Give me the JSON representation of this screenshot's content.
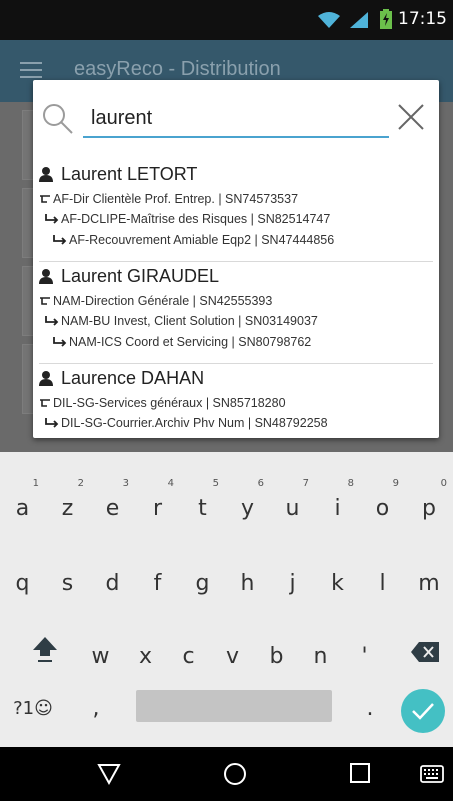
{
  "status": {
    "time": "17:15"
  },
  "app": {
    "title": "easyReco - Distribution"
  },
  "search": {
    "value": "laurent",
    "placeholder": ""
  },
  "results": [
    {
      "name": "Laurent LETORT",
      "lines": [
        "AF-Dir Clientèle Prof. Entrep. | SN74573537",
        "AF-DCLIPE-Maîtrise des Risques | SN82514747",
        "AF-Recouvrement Amiable Eqp2 | SN47444856"
      ]
    },
    {
      "name": "Laurent GIRAUDEL",
      "lines": [
        "NAM-Direction Générale | SN42555393",
        "NAM-BU Invest, Client Solution | SN03149037",
        "NAM-ICS Coord et Servicing | SN80798762"
      ]
    },
    {
      "name": "Laurence DAHAN",
      "lines": [
        "DIL-SG-Services généraux | SN85718280",
        "DIL-SG-Courrier.Archiv Phv Num | SN48792258"
      ]
    }
  ],
  "keyboard": {
    "row1": [
      {
        "ch": "a",
        "hint": "1"
      },
      {
        "ch": "z",
        "hint": "2"
      },
      {
        "ch": "e",
        "hint": "3"
      },
      {
        "ch": "r",
        "hint": "4"
      },
      {
        "ch": "t",
        "hint": "5"
      },
      {
        "ch": "y",
        "hint": "6"
      },
      {
        "ch": "u",
        "hint": "7"
      },
      {
        "ch": "i",
        "hint": "8"
      },
      {
        "ch": "o",
        "hint": "9"
      },
      {
        "ch": "p",
        "hint": "0"
      }
    ],
    "row2": [
      "q",
      "s",
      "d",
      "f",
      "g",
      "h",
      "j",
      "k",
      "l",
      "m"
    ],
    "row3": [
      "w",
      "x",
      "c",
      "v",
      "b",
      "n",
      "'"
    ],
    "symbols_label": "?1☺",
    "comma": ",",
    "period": "."
  },
  "colors": {
    "accent": "#4aa3cf",
    "appbar": "#35586b",
    "done": "#44c0c4"
  }
}
